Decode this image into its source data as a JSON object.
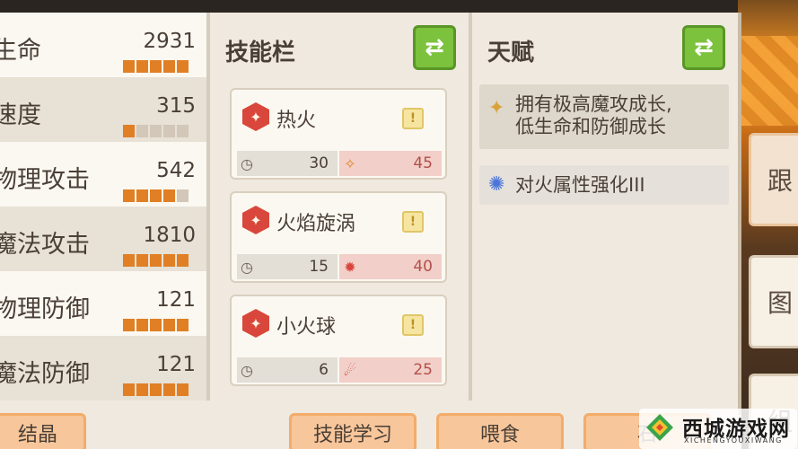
{
  "stats": [
    {
      "name": "生命",
      "value": "2931",
      "level": 5
    },
    {
      "name": "速度",
      "value": "315",
      "level": 1
    },
    {
      "name": "物理攻击",
      "value": "542",
      "level": 4
    },
    {
      "name": "魔法攻击",
      "value": "1810",
      "level": 5
    },
    {
      "name": "物理防御",
      "value": "121",
      "level": 5
    },
    {
      "name": "魔法防御",
      "value": "121",
      "level": 5
    }
  ],
  "skills": {
    "title": "技能栏",
    "swap_icon": "⇄",
    "items": [
      {
        "name": "热火",
        "icon": "fire-icon",
        "cooldown": "30",
        "cost": "45",
        "cost_icon": "sparkle-icon"
      },
      {
        "name": "火焰旋涡",
        "icon": "fire-icon",
        "cooldown": "15",
        "cost": "40",
        "cost_icon": "burst-icon"
      },
      {
        "name": "小火球",
        "icon": "fire-icon",
        "cooldown": "6",
        "cost": "25",
        "cost_icon": "fireball-icon"
      }
    ],
    "warn_glyph": "!"
  },
  "talents": {
    "title": "天赋",
    "swap_icon": "⇄",
    "items": [
      {
        "line1": "拥有极高魔攻成长,",
        "line2": "低生命和防御成长",
        "icon": "star-icon"
      },
      {
        "line1": "对火属性强化III",
        "icon": "spark-icon"
      }
    ]
  },
  "side_tabs": [
    "跟",
    "图",
    "组"
  ],
  "bottom_buttons": {
    "crystal": "结晶",
    "learn": "技能学习",
    "feed": "喂食",
    "partial": "石"
  },
  "watermark": {
    "main": "西城游戏网",
    "sub": "XICHENGYOUXIWANG"
  },
  "colors": {
    "accent_green": "#7cc23d",
    "bar_orange": "#e07f24",
    "cost_red": "#f2cfc9"
  }
}
